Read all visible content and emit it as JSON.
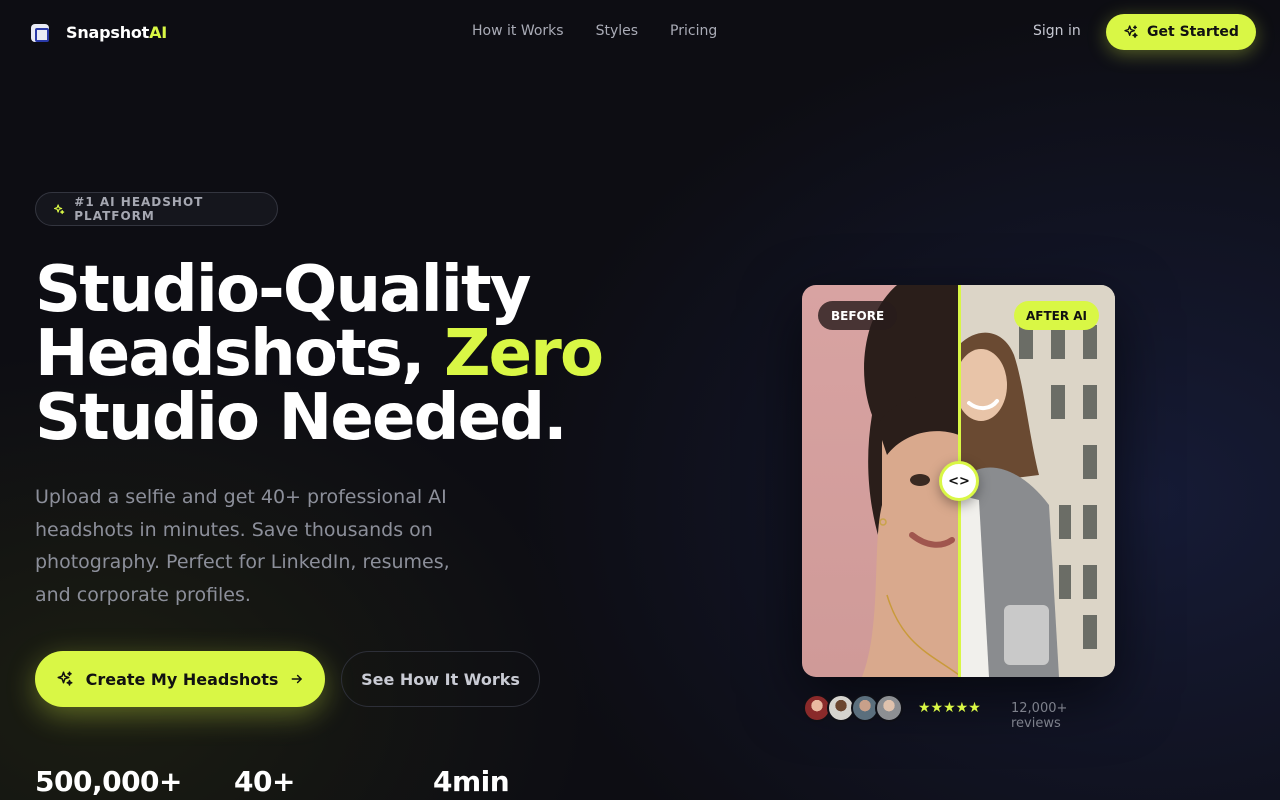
{
  "nav": {
    "brand_main": "Snapshot",
    "brand_accent": "AI",
    "links": [
      "How it Works",
      "Styles",
      "Pricing"
    ],
    "sign_in": "Sign in",
    "get_started": "Get Started"
  },
  "hero": {
    "badge": "#1 AI HEADSHOT PLATFORM",
    "headline_line1": "Studio-Quality",
    "headline_line2_main": "Headshots, ",
    "headline_line2_accent": "Zero",
    "headline_line3": "Studio Needed.",
    "subtitle": "Upload a selfie and get 40+ professional AI headshots in minutes. Save thousands on photography. Perfect for LinkedIn, resumes, and corporate profiles.",
    "cta_primary": "Create My Headshots",
    "cta_secondary": "See How It Works"
  },
  "stats": [
    {
      "value": "500,000+"
    },
    {
      "value": "40+"
    },
    {
      "value": "4min"
    }
  ],
  "comparison": {
    "before_label": "BEFORE",
    "after_label": "AFTER AI",
    "handle_glyph": "<>"
  },
  "reviews": {
    "stars": "★★★★★",
    "count": "12,000+ reviews"
  },
  "colors": {
    "accent": "#d9f745",
    "background": "#0d0d13"
  },
  "icons": [
    "logo-icon",
    "sparkle-icon",
    "arrow-right-icon",
    "compare-handle-icon",
    "star-icon"
  ]
}
